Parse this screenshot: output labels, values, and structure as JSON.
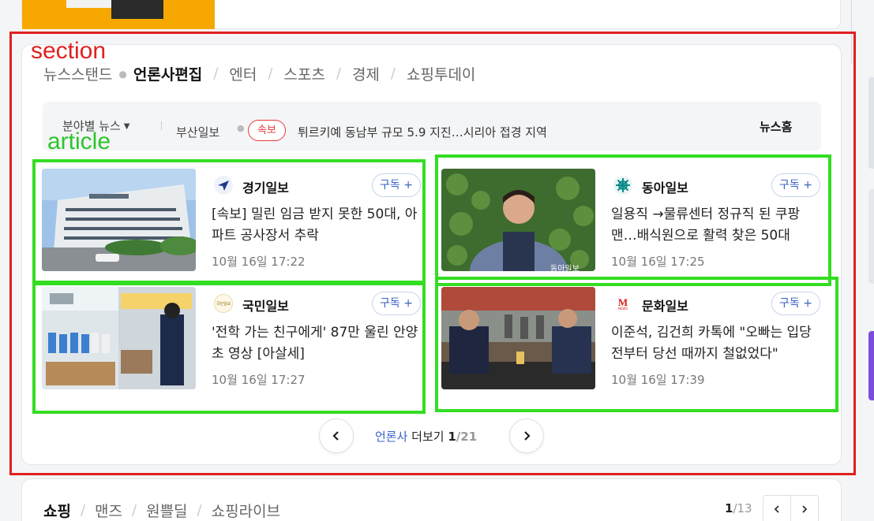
{
  "section": {
    "annotation_label": "section",
    "tabs": [
      {
        "label": "뉴스스탠드"
      },
      {
        "label": "언론사편집"
      },
      {
        "label": "엔터"
      },
      {
        "label": "스포츠"
      },
      {
        "label": "경제"
      },
      {
        "label": "쇼핑투데이"
      }
    ],
    "active_tab_index": 1
  },
  "ticker": {
    "field_label": "분야별 뉴스",
    "press": "부산일보",
    "badge": "속보",
    "headline": "튀르키예 동남부 규모 5.9 지진…시리아 접경 지역",
    "home_link": "뉴스홈"
  },
  "article_annotation_label": "article",
  "articles": [
    {
      "press": "경기일보",
      "subscribe": "구독 +",
      "title": "[속보] 밀린 임금 받지 못한 50대, 아파트 공사장서 추락",
      "time": "10월 16일 17:22",
      "logo_icon": "paper-plane-icon",
      "logo_color": "#1d3a8a"
    },
    {
      "press": "동아일보",
      "subscribe": "구독 +",
      "title": "일용직 →물류센터 정규직 된 쿠팡맨…배식원으로 활력 찾은 50대",
      "time": "10월 16일 17:25",
      "logo_icon": "snowflake-icon",
      "logo_color": "#0f8a8a",
      "photo_caption": "동아일보"
    },
    {
      "press": "국민일보",
      "subscribe": "구독 +",
      "title": "'전학 가는 친구에게' 87만 울린 안양초 영상 [아살세]",
      "time": "10월 16일 17:27",
      "logo_icon": "kukmin-seal-icon",
      "logo_color": "#c9a227",
      "logo_text": "국민일보"
    },
    {
      "press": "문화일보",
      "subscribe": "구독 +",
      "title": "이준석, 김건희 카톡에 \"오빠는 입당 전부터 당선 때까지 철없었다\"",
      "time": "10월 16일 17:39",
      "logo_icon": "m-news-icon",
      "logo_color": "#d61a1a",
      "logo_text": "M",
      "logo_subtext": "NEWS"
    }
  ],
  "pager": {
    "prev_icon": "chevron-left-icon",
    "next_icon": "chevron-right-icon",
    "label_blue": "언론사",
    "label_rest": " 더보기 ",
    "current": "1",
    "total": "/21"
  },
  "shopping": {
    "tabs": [
      {
        "label": "쇼핑"
      },
      {
        "label": "맨즈"
      },
      {
        "label": "원쁠딜"
      },
      {
        "label": "쇼핑라이브"
      }
    ],
    "active_tab_index": 0,
    "page_current": "1",
    "page_total": "/13"
  },
  "colors": {
    "annotation_section": "#e02020",
    "annotation_article": "#33dd22",
    "subscribe_accent": "#3a63c5",
    "breaking_red": "#e83a3a",
    "top_banner": "#f7a800"
  }
}
